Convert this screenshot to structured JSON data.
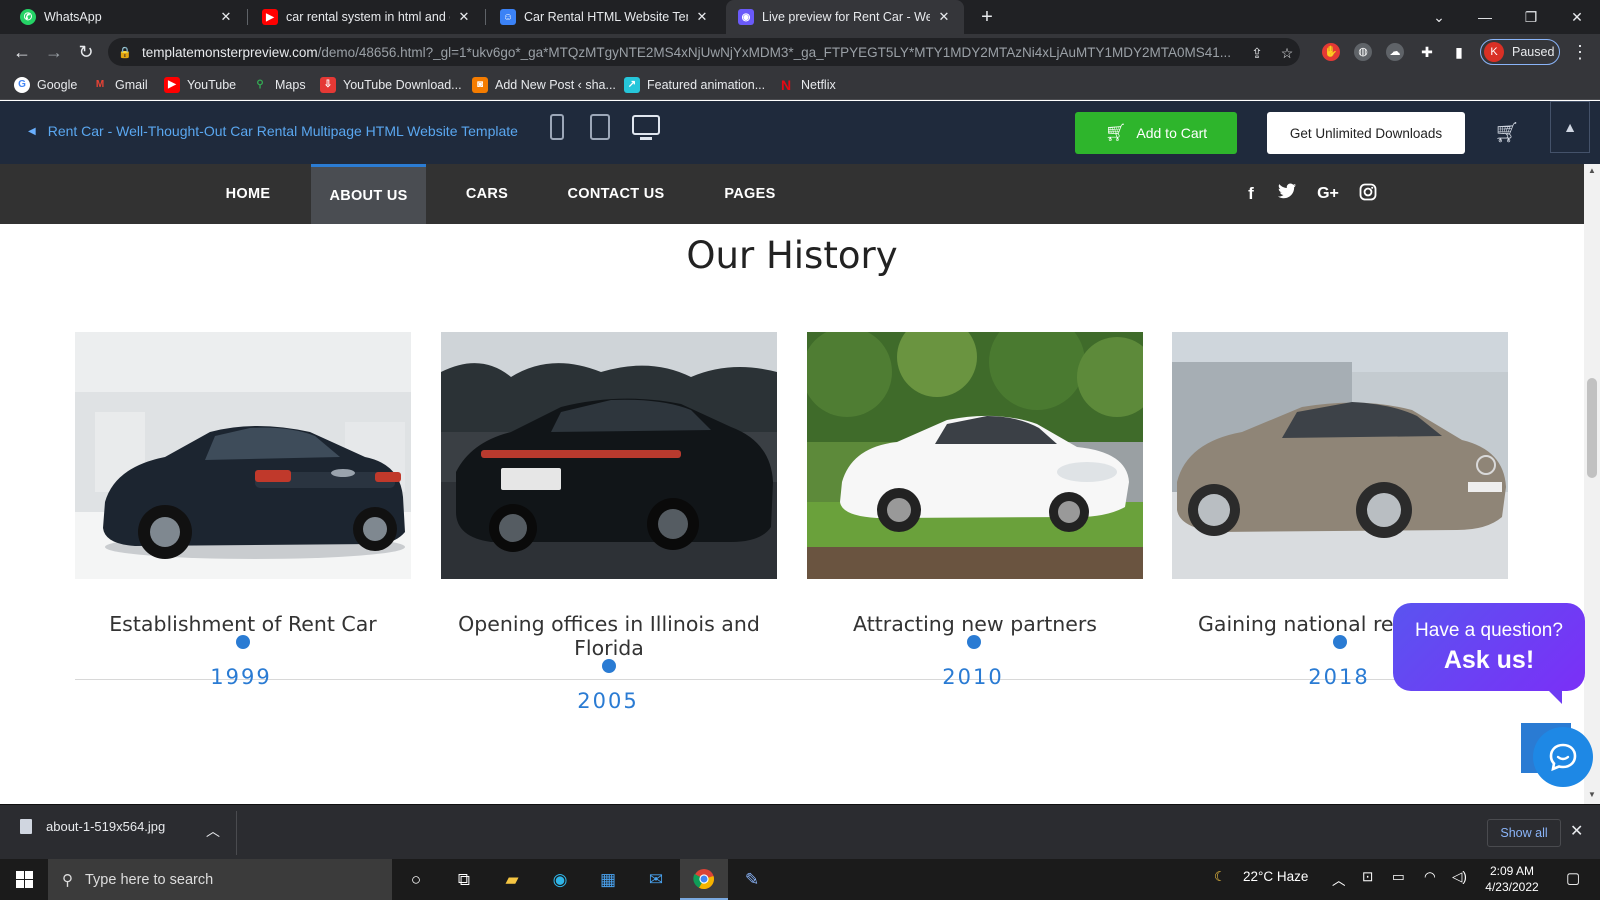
{
  "browser": {
    "tabs": [
      {
        "title": "WhatsApp",
        "icon": "whatsapp-icon"
      },
      {
        "title": "car rental system in html and css",
        "icon": "youtube-icon"
      },
      {
        "title": "Car Rental HTML Website Templa",
        "icon": "templatemonster-icon"
      },
      {
        "title": "Live preview for Rent Car - Well-T",
        "icon": "preview-icon"
      }
    ],
    "url_host": "templatemonsterpreview.com",
    "url_path": "/demo/48656.html?_gl=1*ukv6go*_ga*MTQzMTgyNTE2MS4xNjUwNjYxMDM3*_ga_FTPYEGT5LY*MTY1MDY2MTAzNi4xLjAuMTY1MDY2MTA0MS41...",
    "profile_initial": "K",
    "profile_status": "Paused",
    "bookmarks": [
      "Google",
      "Gmail",
      "YouTube",
      "Maps",
      "YouTube Download...",
      "Add New Post ‹ sha...",
      "Featured animation...",
      "Netflix"
    ]
  },
  "preview_bar": {
    "back_title": "Rent Car - Well-Thought-Out Car Rental Multipage HTML Website Template",
    "add_to_cart": "Add to Cart",
    "unlimited": "Get Unlimited Downloads",
    "accent_green": "#2eb52c"
  },
  "site_nav": {
    "items": [
      "HOME",
      "ABOUT US",
      "CARS",
      "CONTACT US",
      "PAGES"
    ],
    "active": "ABOUT US",
    "social_icons": [
      "facebook-icon",
      "twitter-icon",
      "google-plus-icon",
      "instagram-icon"
    ],
    "social_glyphs": [
      "f",
      "𝕥",
      "G+",
      "◎"
    ]
  },
  "history": {
    "title": "Our History",
    "accent": "#2a7bd3",
    "items": [
      {
        "caption": "Establishment of Rent Car",
        "year": "1999",
        "image": "black audi coupe"
      },
      {
        "caption": "Opening offices in Illinois and Florida",
        "year": "2005",
        "image": "black porsche panamera"
      },
      {
        "caption": "Attracting new partners",
        "year": "2010",
        "image": "white tesla model s"
      },
      {
        "caption": "Gaining national re",
        "year": "2018",
        "image": "grey mercedes cls"
      }
    ]
  },
  "chat": {
    "question": "Have a question?",
    "cta": "Ask us!"
  },
  "downloads": {
    "file": "about-1-519x564.jpg",
    "show_all": "Show all"
  },
  "taskbar": {
    "search_placeholder": "Type here to search",
    "weather": "22°C  Haze",
    "time": "2:09 AM",
    "date": "4/23/2022"
  }
}
